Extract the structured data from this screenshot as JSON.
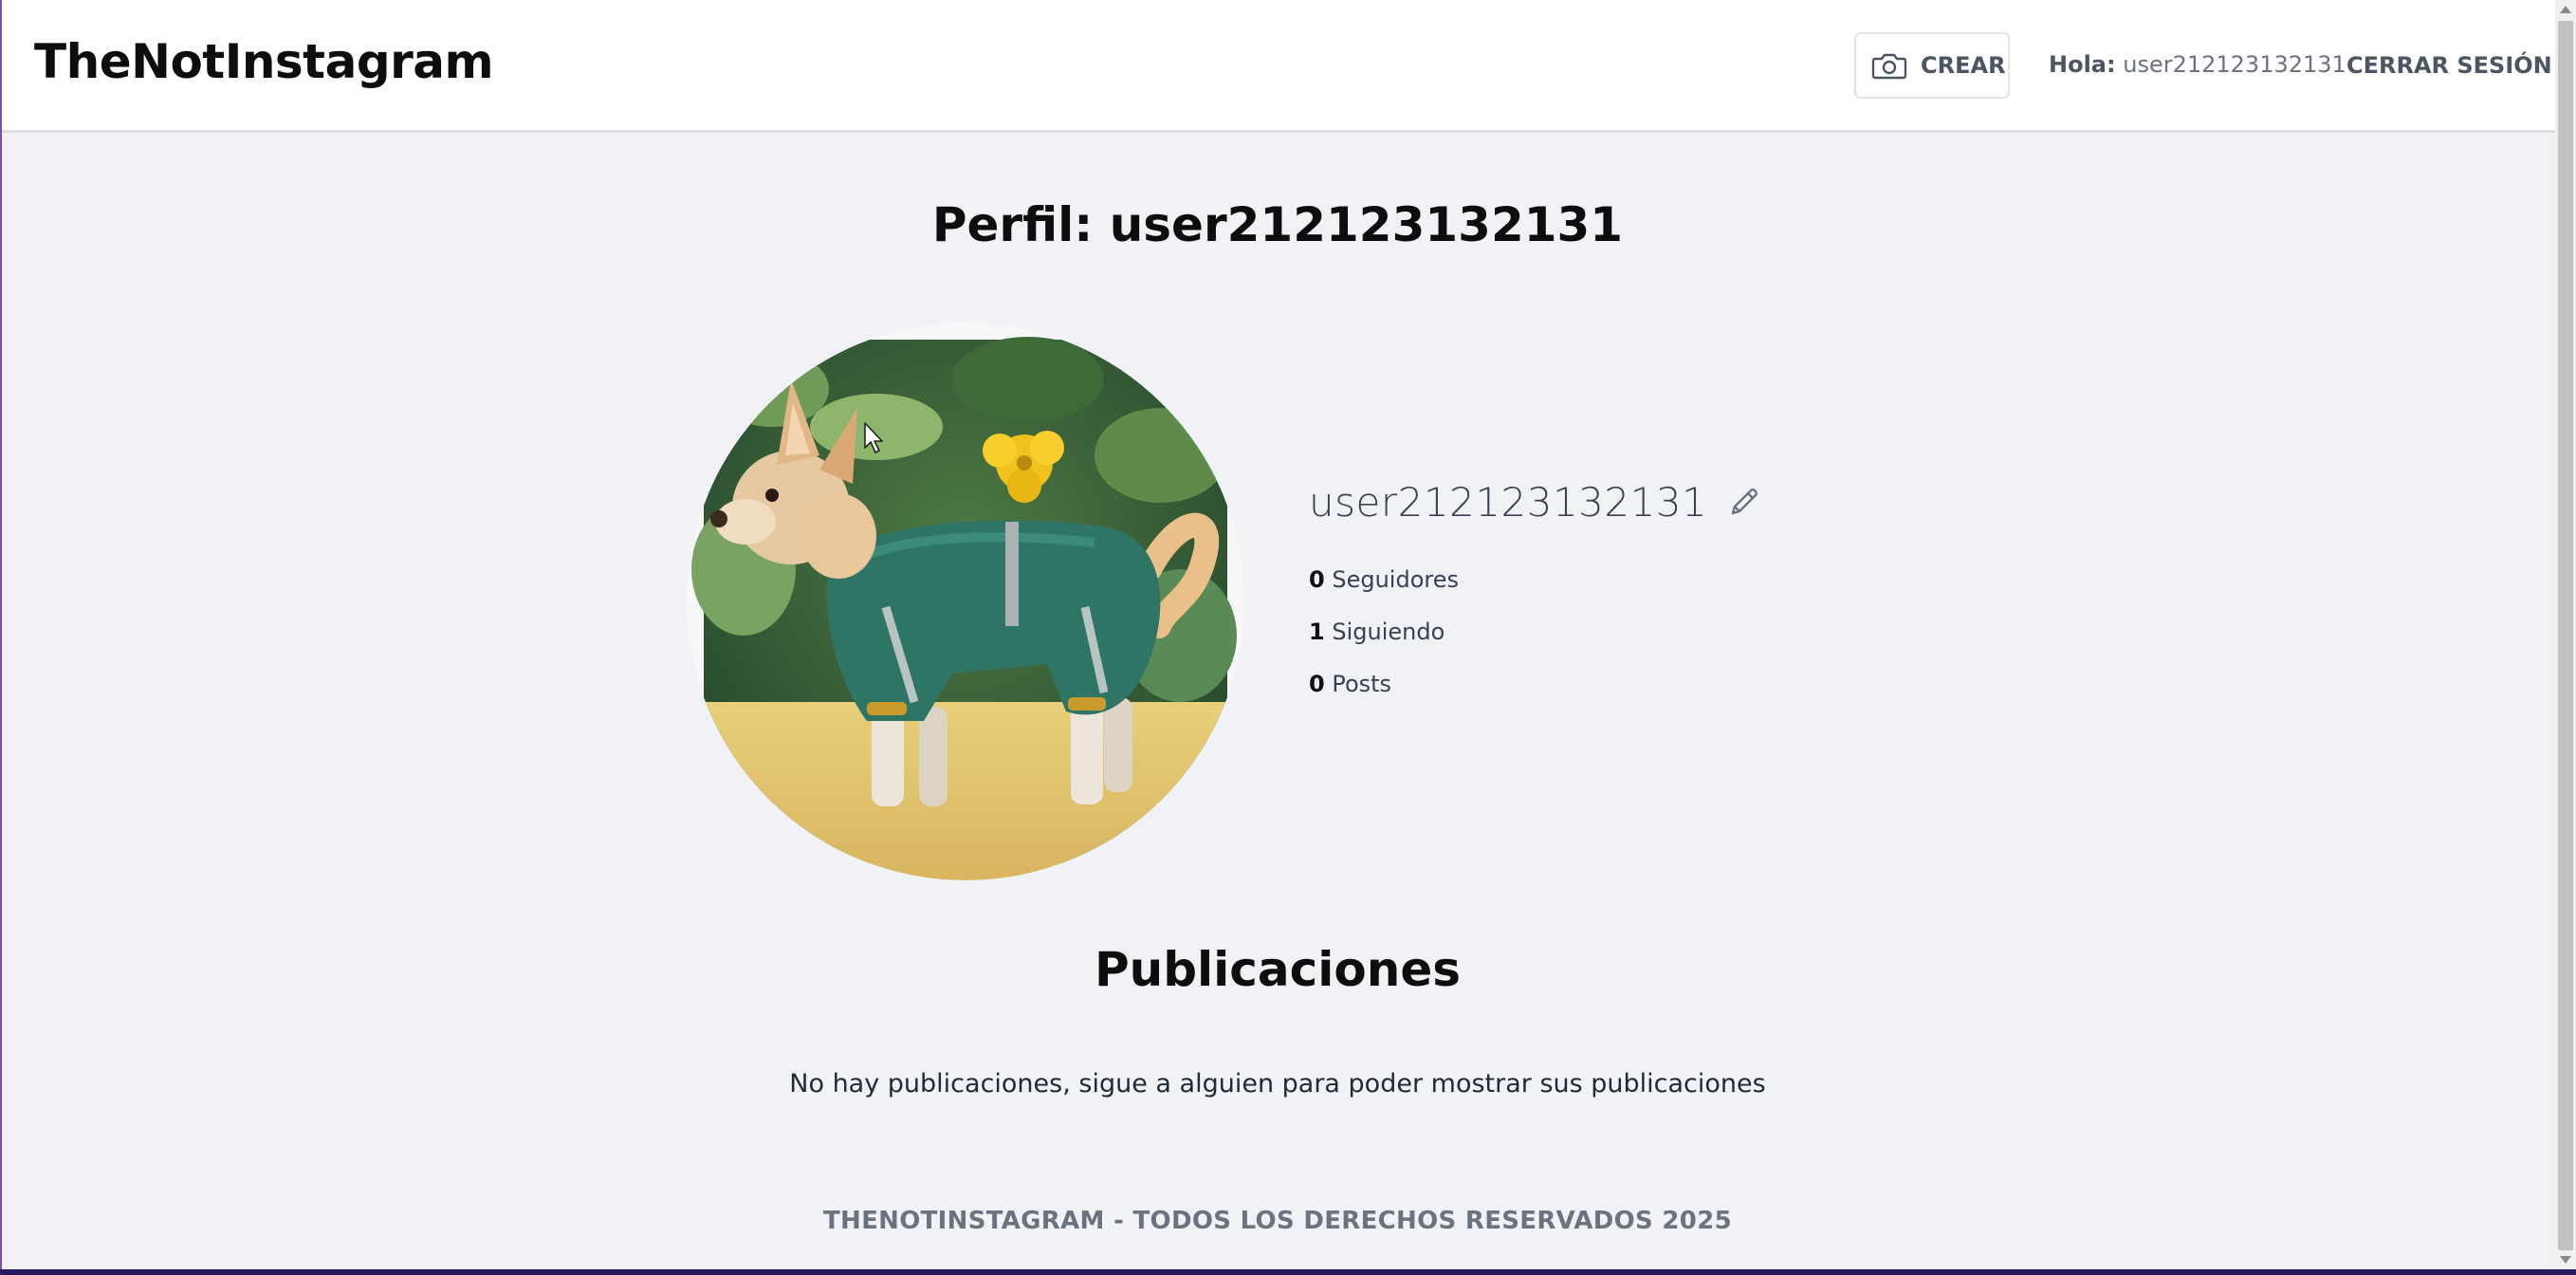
{
  "header": {
    "brand": "TheNotInstagram",
    "create_label": "CREAR",
    "greeting_label": "Hola:",
    "greeting_user": "user212123132131",
    "logout_label": "CERRAR SESIÓN"
  },
  "profile": {
    "page_title": "Perfil: user212123132131",
    "username": "user212123132131",
    "stats": [
      {
        "count": "0",
        "label": "Seguidores"
      },
      {
        "count": "1",
        "label": "Siguiendo"
      },
      {
        "count": "0",
        "label": "Posts"
      }
    ]
  },
  "posts": {
    "title": "Publicaciones",
    "empty_message": "No hay publicaciones, sigue a alguien para poder mostrar sus publicaciones"
  },
  "footer": {
    "text": "THENOTINSTAGRAM - TODOS LOS DERECHOS RESERVADOS 2025"
  },
  "icons": {
    "create": "camera-icon",
    "edit": "pencil-icon"
  }
}
